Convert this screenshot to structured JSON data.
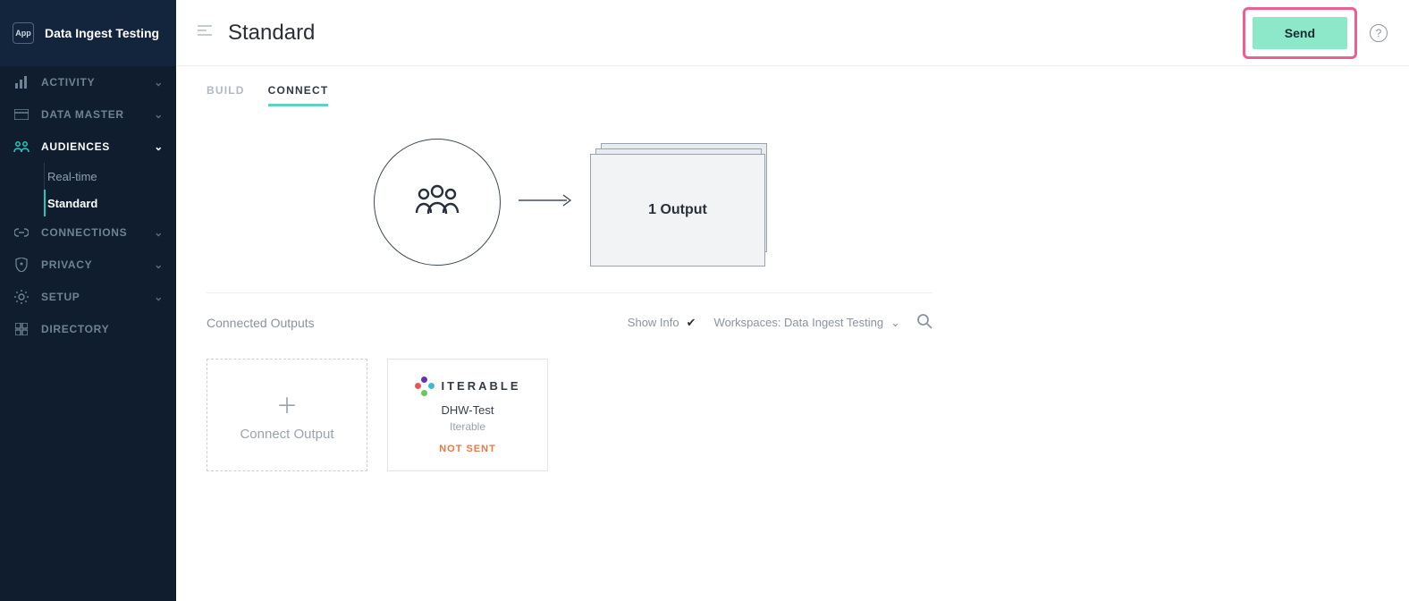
{
  "sidebar": {
    "app_badge": "App",
    "workspace": "Data Ingest Testing",
    "items": [
      {
        "label": "Activity",
        "icon": "bars-icon"
      },
      {
        "label": "Data Master",
        "icon": "panel-icon"
      },
      {
        "label": "Audiences",
        "icon": "people-icon"
      },
      {
        "label": "Connections",
        "icon": "link-icon"
      },
      {
        "label": "Privacy",
        "icon": "shield-icon"
      },
      {
        "label": "Setup",
        "icon": "gear-icon"
      },
      {
        "label": "Directory",
        "icon": "grid-icon"
      }
    ],
    "audiences_sub": [
      {
        "label": "Real-time"
      },
      {
        "label": "Standard"
      }
    ]
  },
  "header": {
    "title": "Standard",
    "send_label": "Send"
  },
  "tabs": [
    {
      "label": "BUILD"
    },
    {
      "label": "CONNECT"
    }
  ],
  "diagram": {
    "output_text": "1 Output"
  },
  "outputs": {
    "section_label": "Connected Outputs",
    "show_info_label": "Show Info",
    "workspace_label": "Workspaces: Data Ingest Testing",
    "connect_label": "Connect Output",
    "cards": [
      {
        "logo_word": "ITERABLE",
        "name": "DHW-Test",
        "subname": "Iterable",
        "status": "NOT SENT"
      }
    ]
  }
}
